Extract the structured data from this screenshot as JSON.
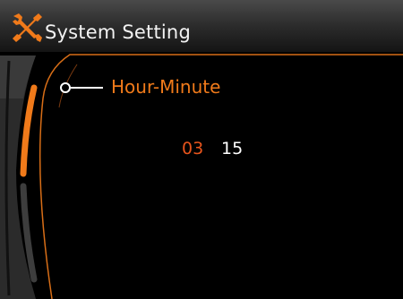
{
  "header": {
    "title": "System Setting",
    "icon": "wrench-screwdriver-icon"
  },
  "settings": {
    "item_label": "Hour-Minute",
    "hour": "03",
    "minute": "15"
  },
  "colors": {
    "accent": "#f07a1a",
    "selected_value": "#e8541c",
    "value": "#ffffff",
    "background": "#000000"
  }
}
